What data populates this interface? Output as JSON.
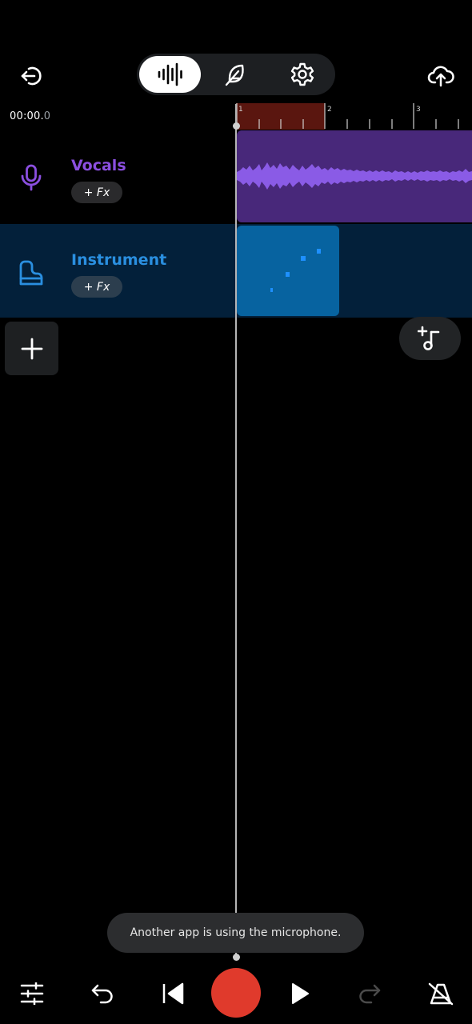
{
  "header": {
    "back_icon": "exit-arrow-icon",
    "modes": [
      {
        "name": "waveform-icon",
        "active": true
      },
      {
        "name": "feather-icon",
        "active": false
      },
      {
        "name": "settings-gear-icon",
        "active": false
      }
    ],
    "upload_icon": "cloud-upload-icon"
  },
  "time": {
    "main": "00:00.",
    "fraction": "0"
  },
  "ruler": {
    "labels": [
      "1",
      "2",
      "3"
    ],
    "loop_color": "#5a160f"
  },
  "tracks": [
    {
      "name": "Vocals",
      "fx_label": "+ Fx",
      "icon": "microphone-icon",
      "color": "#8b4fe0",
      "clip_color": "#48287a",
      "wave_color": "#8a5be6",
      "header_bg": "#000000",
      "selected": false
    },
    {
      "name": "Instrument",
      "fx_label": "+ Fx",
      "icon": "piano-icon",
      "color": "#2a8fe0",
      "clip_color": "#0763a0",
      "note_color": "#1e90ff",
      "header_bg": "#03203a",
      "selected": true
    }
  ],
  "add_track_icon": "plus-icon",
  "add_note_icon": "add-music-note-icon",
  "toast": {
    "message": "Another app is using the microphone."
  },
  "transport": {
    "items": [
      "mixer-sliders-icon",
      "undo-icon",
      "skip-to-start-icon",
      "record-button",
      "play-icon",
      "redo-icon",
      "metronome-off-icon"
    ],
    "record_color": "#e03a2c"
  }
}
